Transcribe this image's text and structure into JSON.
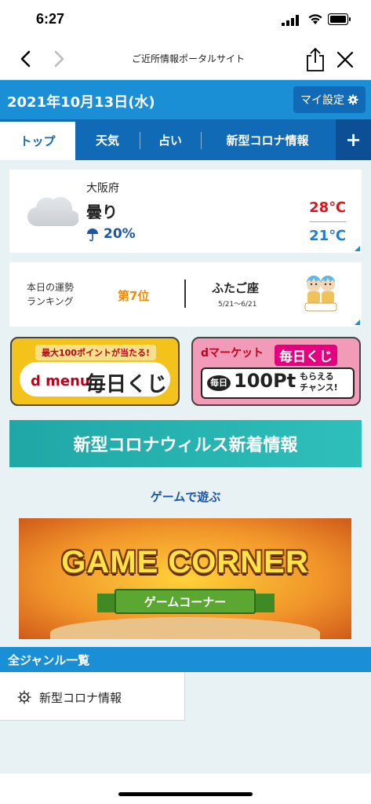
{
  "status_bar": {
    "time": "6:27"
  },
  "nav": {
    "title": "ご近所情報ポータルサイト"
  },
  "date_bar": {
    "date": "2021年10月13日(水)",
    "settings_label": "マイ設定"
  },
  "tabs": [
    {
      "label": "トップ"
    },
    {
      "label": "天気"
    },
    {
      "label": "占い"
    },
    {
      "label": "新型コロナ情報"
    }
  ],
  "tabs_plus": "+",
  "weather": {
    "prefecture": "大阪府",
    "condition": "曇り",
    "rain_chance": "20%",
    "temp_high": "28℃",
    "temp_low": "21℃",
    "icon": "cloud-icon"
  },
  "fortune": {
    "label_line1": "本日の運勢",
    "label_line2": "ランキング",
    "rank": "第7位",
    "sign": "ふたご座",
    "dates": "5/21〜6/21",
    "icon": "gemini-icon"
  },
  "banners": {
    "dmenu": {
      "tag": "最大100ポイントが当たる!",
      "logo": "d menu",
      "title": "毎日くじ"
    },
    "dmarket": {
      "name": "dマーケット",
      "daily": "毎日くじ",
      "badge": "毎日",
      "points": "100Pt",
      "chance_line1": "もらえる",
      "chance_line2": "チャンス!"
    },
    "covid": "新型コロナウィルス新着情報"
  },
  "games": {
    "section_label": "ゲームで遊ぶ",
    "title": "GAME CORNER",
    "subtitle": "ゲームコーナー"
  },
  "genres": {
    "header": "全ジャンル一覧",
    "items": [
      {
        "label": "新型コロナ情報",
        "icon": "virus-icon"
      }
    ]
  },
  "colors": {
    "primary": "#1a8fd6",
    "tab_bar": "#116ab6",
    "temp_high": "#e0141e",
    "temp_low": "#1a7fd6",
    "rank": "#f08a00",
    "covid_banner": "#1fa7a6"
  }
}
